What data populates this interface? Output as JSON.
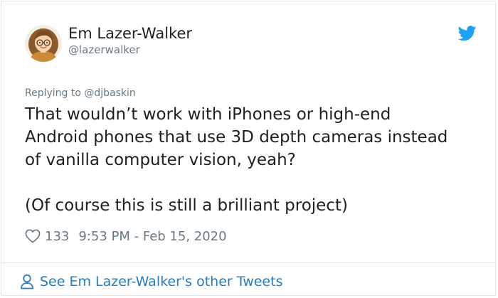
{
  "author": {
    "display_name": "Em Lazer-Walker",
    "handle": "@lazerwalker"
  },
  "reply": {
    "prefix": "Replying to",
    "mention": "@djbaskin"
  },
  "tweet": {
    "lines": [
      "That wouldn’t work with iPhones or high-end",
      "Android phones that use 3D depth cameras instead",
      "of vanilla computer vision, yeah?"
    ],
    "aside": "(Of course this is still a brilliant project)"
  },
  "meta": {
    "like_count": "133",
    "timestamp": "9:53 PM - Feb 15, 2020"
  },
  "footer": {
    "link_label": "See Em Lazer-Walker's other Tweets"
  },
  "icons": {
    "brand": "twitter-bird-icon",
    "like": "heart-outline-icon",
    "profile": "person-outline-icon"
  },
  "colors": {
    "brand_blue": "#1da1f2",
    "link_blue": "#2b7bb9",
    "secondary_text": "#697882",
    "primary_text": "#1c2022",
    "border": "#e1e8ed"
  }
}
